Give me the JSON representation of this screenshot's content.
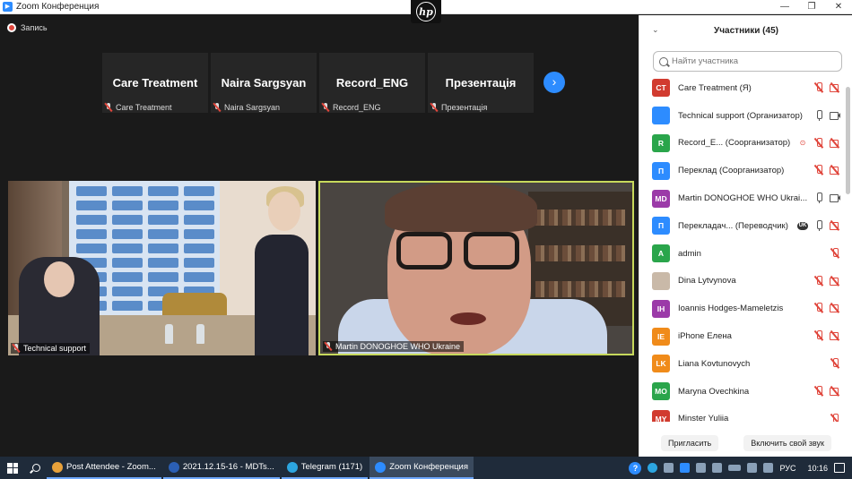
{
  "window": {
    "title": "Zoom Конференция",
    "controls": [
      "—",
      "❐",
      "✕"
    ]
  },
  "recording": {
    "label": "Запись"
  },
  "strip": [
    {
      "name": "Care Treatment",
      "tag": "Care Treatment"
    },
    {
      "name": "Naira Sargsyan",
      "tag": "Naira Sargsyan"
    },
    {
      "name": "Record_ENG",
      "tag": "Record_ENG"
    },
    {
      "name": "Презентація",
      "tag": "Презентація"
    }
  ],
  "next_icon": "chevron-right-icon",
  "videos": [
    {
      "tag": "Technical support"
    },
    {
      "tag": "Martin DONOGHOE WHO Ukraine"
    }
  ],
  "panel": {
    "title": "Участники (45)",
    "search_placeholder": "Найти участника",
    "participants": [
      {
        "initials": "CT",
        "color": "#d13b2f",
        "name": "Care Treatment (Я)",
        "icons": [
          "mic-off",
          "video-off"
        ]
      },
      {
        "initials": "",
        "color": "#2d8cff",
        "name": "Technical support (Организатор)",
        "icons": [
          "mic",
          "video"
        ]
      },
      {
        "initials": "R",
        "color": "#2aa54b",
        "name": "Record_E... (Соорганизатор)",
        "icons": [
          "record",
          "mic-off",
          "video-off"
        ]
      },
      {
        "initials": "П",
        "color": "#2d8cff",
        "name": "Переклад (Соорганизатор)",
        "icons": [
          "mic-off",
          "video-off"
        ]
      },
      {
        "initials": "MD",
        "color": "#9b3aa8",
        "name": "Martin DONOGHOE WHO Ukrai...",
        "icons": [
          "mic",
          "video"
        ]
      },
      {
        "initials": "П",
        "color": "#2d8cff",
        "name": "Перекладач... (Переводчик)",
        "icons": [
          "uk",
          "mic",
          "video-off"
        ]
      },
      {
        "initials": "A",
        "color": "#2aa54b",
        "name": "admin",
        "icons": [
          "mic-off"
        ]
      },
      {
        "initials": "",
        "color": "#c9b9a8",
        "name": "Dina Lytvynova",
        "icons": [
          "mic-off",
          "video-off"
        ]
      },
      {
        "initials": "IH",
        "color": "#9b3aa8",
        "name": "Ioannis Hodges-Mameletzis",
        "icons": [
          "mic-off",
          "video-off"
        ]
      },
      {
        "initials": "IE",
        "color": "#f08b1a",
        "name": "iPhone Елена",
        "icons": [
          "mic-off",
          "video-off"
        ]
      },
      {
        "initials": "LK",
        "color": "#f08b1a",
        "name": "Liana Kovtunovych",
        "icons": [
          "mic-off"
        ]
      },
      {
        "initials": "MO",
        "color": "#2aa54b",
        "name": "Maryna Ovechkina",
        "icons": [
          "mic-off",
          "video-off"
        ]
      },
      {
        "initials": "MY",
        "color": "#d13b2f",
        "name": "Minster Yuliia",
        "icons": [
          "mic-off"
        ]
      }
    ],
    "invite_label": "Пригласить",
    "unmute_label": "Включить свой звук"
  },
  "taskbar": {
    "items": [
      {
        "label": "Post Attendee - Zoom...",
        "color": "#e8a13a"
      },
      {
        "label": "2021.12.15-16 - MDTs...",
        "color": "#2b5fb5"
      },
      {
        "label": "Telegram (1171)",
        "color": "#2ca5e0"
      },
      {
        "label": "Zoom Конференция",
        "color": "#2d8cff"
      }
    ],
    "lang": "РУС",
    "time": "10:16"
  }
}
